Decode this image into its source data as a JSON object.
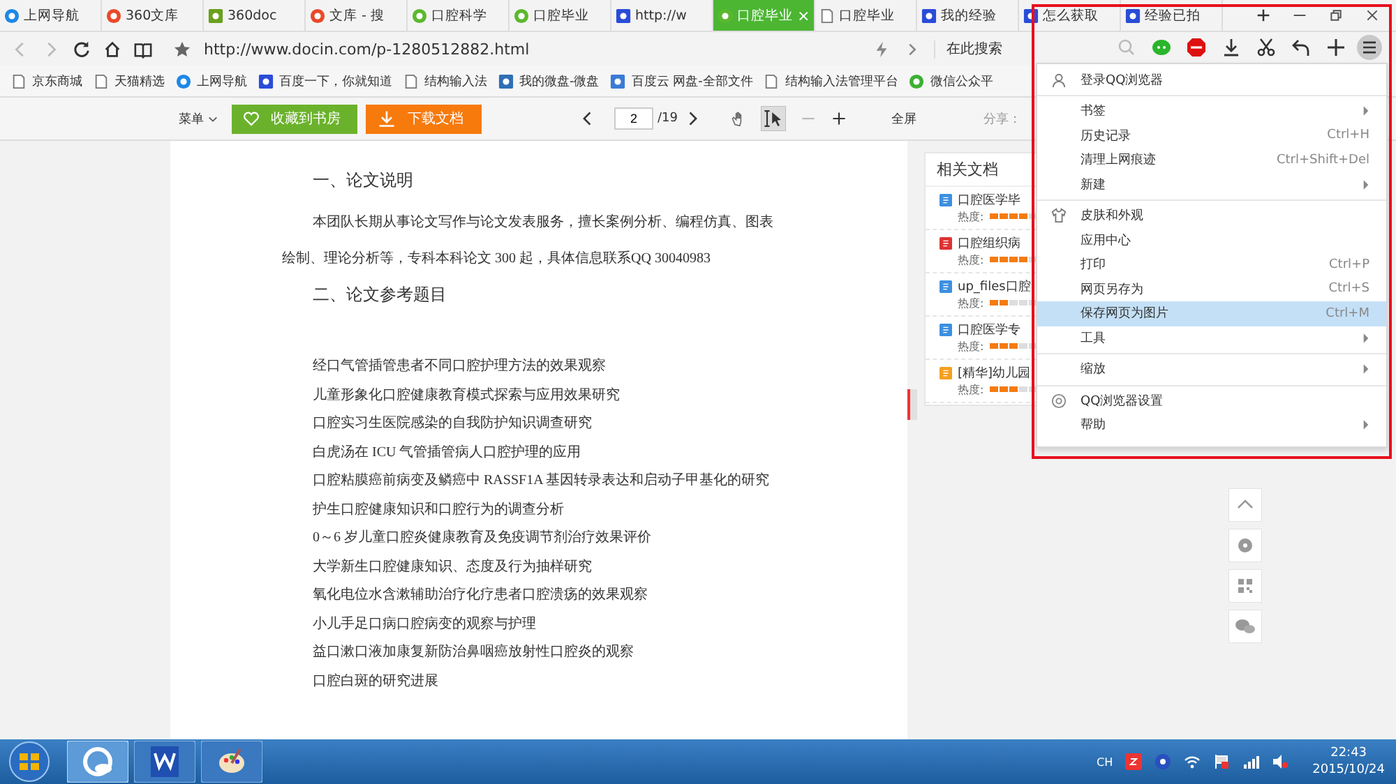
{
  "tabs": [
    {
      "label": "上网导航",
      "kind": "ie",
      "selected": false
    },
    {
      "label": "360文库",
      "kind": "s360",
      "selected": false
    },
    {
      "label": "360doc",
      "kind": "doc",
      "selected": false
    },
    {
      "label": "文库 - 搜",
      "kind": "s360",
      "selected": false
    },
    {
      "label": "口腔科学",
      "kind": "docin",
      "selected": false
    },
    {
      "label": "口腔毕业",
      "kind": "docin",
      "selected": false
    },
    {
      "label": "http://w",
      "kind": "paw",
      "selected": false
    },
    {
      "label": "口腔毕业",
      "kind": "docin",
      "selected": true
    },
    {
      "label": "口腔毕业",
      "kind": "page",
      "selected": false
    },
    {
      "label": "我的经验",
      "kind": "paw",
      "selected": false
    },
    {
      "label": "怎么获取",
      "kind": "paw",
      "selected": false
    },
    {
      "label": "经验已拍",
      "kind": "paw",
      "selected": false
    }
  ],
  "close_tab": "×",
  "address_bar": {
    "url": "http://www.docin.com/p-1280512882.html",
    "search_placeholder": "在此搜索"
  },
  "bookmarks": [
    {
      "label": "京东商城",
      "kind": "page"
    },
    {
      "label": "天猫精选",
      "kind": "page"
    },
    {
      "label": "上网导航",
      "kind": "ie"
    },
    {
      "label": "百度一下，你就知道",
      "kind": "paw"
    },
    {
      "label": "结构输入法",
      "kind": "page"
    },
    {
      "label": "我的微盘-微盘",
      "kind": "vdisk"
    },
    {
      "label": "百度云 网盘-全部文件",
      "kind": "cloud"
    },
    {
      "label": "结构输入法管理平台",
      "kind": "page"
    },
    {
      "label": "微信公众平",
      "kind": "wechat"
    }
  ],
  "doc_toolbar": {
    "menu": "菜单",
    "favorite": "收藏到书房",
    "download": "下载文档",
    "page": "2",
    "page_total": "/19",
    "fullscreen": "全屏",
    "share": "分享："
  },
  "document": {
    "heading_1": "一、论文说明",
    "paragraph_lines": [
      "本团队长期从事论文写作与论文发表服务，擅长案例分析、编程仿真、图表",
      "绘制、理论分析等，专科本科论文 300 起，具体信息联系QQ 30040983"
    ],
    "heading_2": "二、论文参考题目",
    "topics": [
      "经口气管插管患者不同口腔护理方法的效果观察",
      "儿童形象化口腔健康教育模式探索与应用效果研究",
      "口腔实习生医院感染的自我防护知识调查研究",
      "白虎汤在 ICU 气管插管病人口腔护理的应用",
      "口腔粘膜癌前病变及鳞癌中 RASSF1A 基因转录表达和启动子甲基化的研究",
      "护生口腔健康知识和口腔行为的调查分析",
      "0～6 岁儿童口腔炎健康教育及免疫调节剂治疗效果评价",
      "大学新生口腔健康知识、态度及行为抽样研究",
      "氧化电位水含漱辅助治疗化疗患者口腔溃疡的效果观察",
      "小儿手足口病口腔病变的观察与护理",
      "益口漱口液加康复新防治鼻咽癌放射性口腔炎的观察",
      "口腔白斑的研究进展"
    ]
  },
  "related": {
    "title": "相关文档",
    "items": [
      {
        "title": "口腔医学毕",
        "kind": "word",
        "heat_label": "热度:",
        "stars": 4
      },
      {
        "title": "口腔组织病",
        "kind": "pdf",
        "heat_label": "热度:",
        "stars": 4
      },
      {
        "title": "up_files口腔",
        "kind": "word",
        "heat_label": "热度:",
        "stars": 2
      },
      {
        "title": "口腔医学专",
        "kind": "word",
        "heat_label": "热度:",
        "stars": 3
      },
      {
        "title": "[精华]幼儿园",
        "kind": "other",
        "heat_label": "热度:",
        "stars": 3
      }
    ]
  },
  "menu": {
    "account": "登录QQ浏览器",
    "groups": [
      [
        {
          "label": "书签",
          "submenu": true,
          "selected": false
        },
        {
          "label": "历史记录",
          "shortcut": "Ctrl+H",
          "submenu": false,
          "selected": false
        },
        {
          "label": "清理上网痕迹",
          "shortcut": "Ctrl+Shift+Del",
          "submenu": false,
          "selected": false
        },
        {
          "label": "新建",
          "submenu": true,
          "selected": false
        }
      ],
      [
        {
          "label": "皮肤和外观",
          "submenu": false,
          "selected": false
        },
        {
          "label": "应用中心",
          "submenu": false,
          "selected": false
        },
        {
          "label": "打印",
          "shortcut": "Ctrl+P",
          "submenu": false,
          "selected": false
        },
        {
          "label": "网页另存为",
          "shortcut": "Ctrl+S",
          "submenu": false,
          "selected": false
        },
        {
          "label": "保存网页为图片",
          "shortcut": "Ctrl+M",
          "submenu": false,
          "selected": true
        },
        {
          "label": "工具",
          "submenu": true,
          "selected": false
        }
      ],
      [
        {
          "label": "缩放",
          "submenu": true,
          "selected": false
        }
      ],
      [
        {
          "label": "QQ浏览器设置",
          "submenu": false,
          "selected": false
        },
        {
          "label": "帮助",
          "submenu": true,
          "selected": false
        }
      ]
    ]
  },
  "taskbar": {
    "language": "CH",
    "time": "22:43",
    "date": "2015/10/24"
  }
}
